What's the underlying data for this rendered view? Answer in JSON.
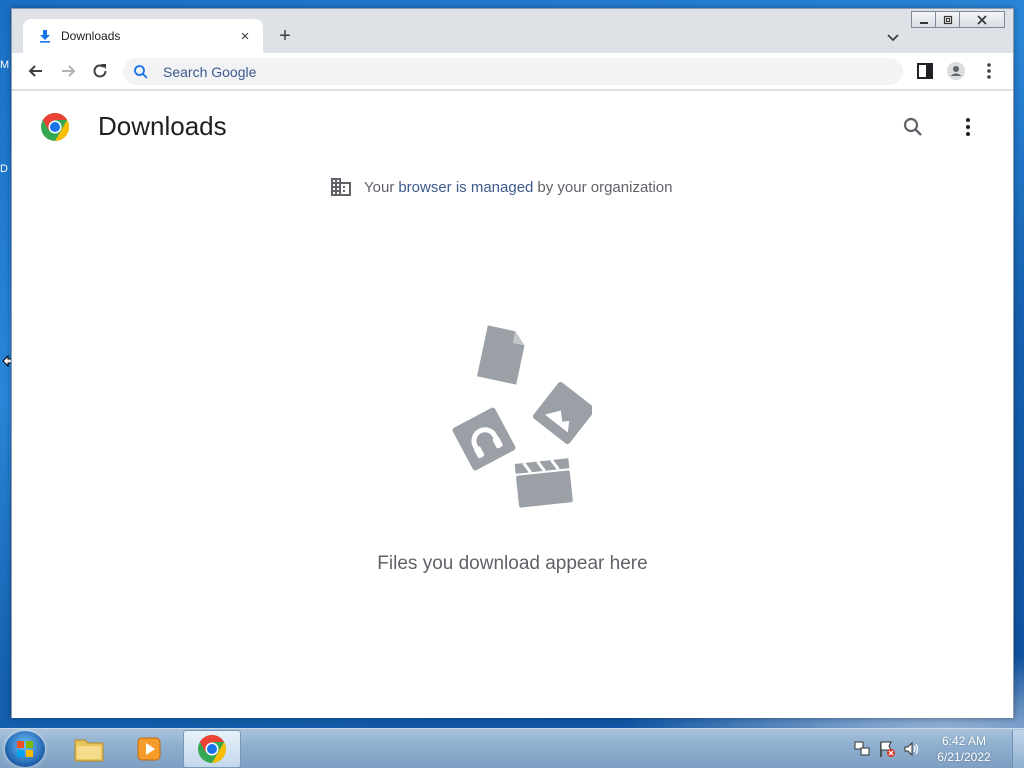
{
  "window": {
    "tab_title": "Downloads",
    "tab_close_glyph": "×",
    "new_tab_glyph": "+",
    "caption": {
      "minimize": "—",
      "maximize": "▢",
      "close": "✕"
    }
  },
  "toolbar": {
    "omnibox_placeholder": "Search Google"
  },
  "page": {
    "title": "Downloads",
    "managed": {
      "prefix": "Your",
      "link": "browser is managed",
      "suffix": "by your organization"
    },
    "empty_message": "Files you download appear here"
  },
  "taskbar": {
    "time": "6:42 AM",
    "date": "6/21/2022"
  },
  "desktop": {
    "edge_letters": [
      "M",
      "D"
    ]
  },
  "colors": {
    "accent_blue": "#1a73e8",
    "link": "#3c5a8c",
    "illustration_grey": "#9aa0a6",
    "text_secondary": "#5f6368"
  }
}
